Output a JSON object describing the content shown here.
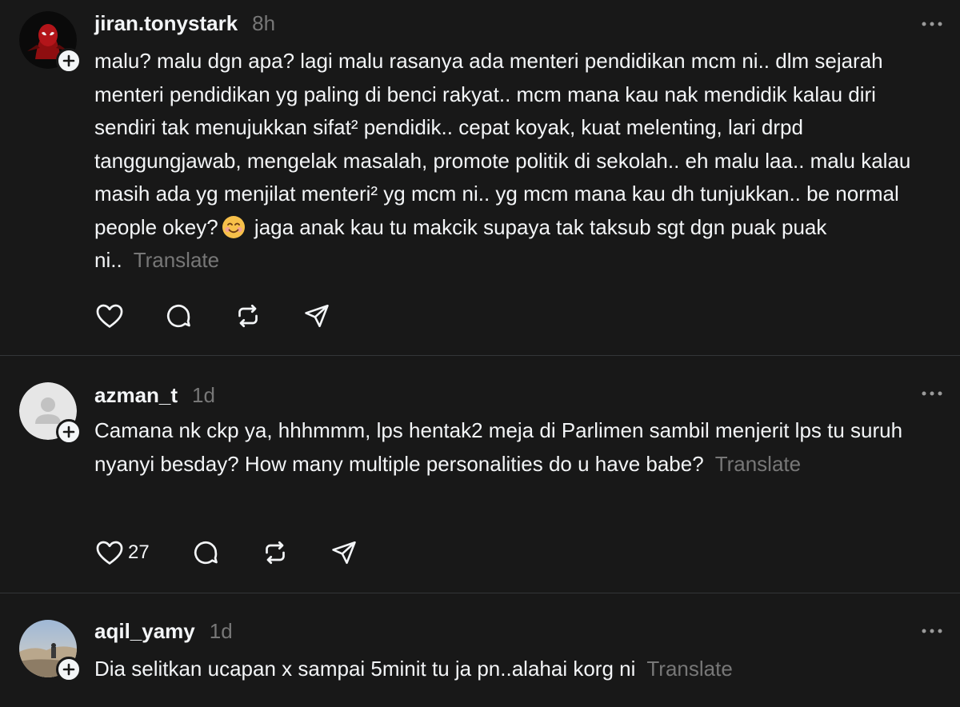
{
  "posts": [
    {
      "username": "jiran.tonystark",
      "time": "8h",
      "text": "malu? malu dgn apa? lagi malu rasanya ada menteri pendidikan mcm ni.. dlm sejarah menteri pendidikan yg paling di benci rakyat.. mcm mana kau nak mendidik kalau diri sendiri tak menujukkan sifat² pendidik.. cepat koyak, kuat melenting, lari drpd tanggungjawab, mengelak masalah, promote politik di sekolah.. eh malu laa.. malu kalau masih ada yg menjilat menteri² yg mcm ni.. yg mcm mana kau dh tunjukkan.. be normal people okey?",
      "text_after_emoji": "jaga anak kau tu makcik supaya tak taksub sgt dgn puak puak ni..",
      "emoji": "smiling-face-emoji",
      "translate": "Translate",
      "likes": ""
    },
    {
      "username": "azman_t",
      "time": "1d",
      "text": "Camana nk ckp ya, hhhmmm, lps hentak2 meja di Parlimen sambil menjerit lps tu suruh nyanyi besday? How many multiple personalities do u have babe?",
      "translate": "Translate",
      "likes": "27"
    },
    {
      "username": "aqil_yamy",
      "time": "1d",
      "text": "Dia selitkan ucapan x sampai 5minit tu ja pn..alahai korg ni",
      "translate": "Translate"
    }
  ],
  "colors": {
    "background": "#181818",
    "text": "#f3f5f7",
    "muted": "#777777",
    "divider": "#333638"
  },
  "icons": [
    "heart-icon",
    "comment-icon",
    "repost-icon",
    "share-icon",
    "more-icon",
    "follow-plus-icon"
  ]
}
